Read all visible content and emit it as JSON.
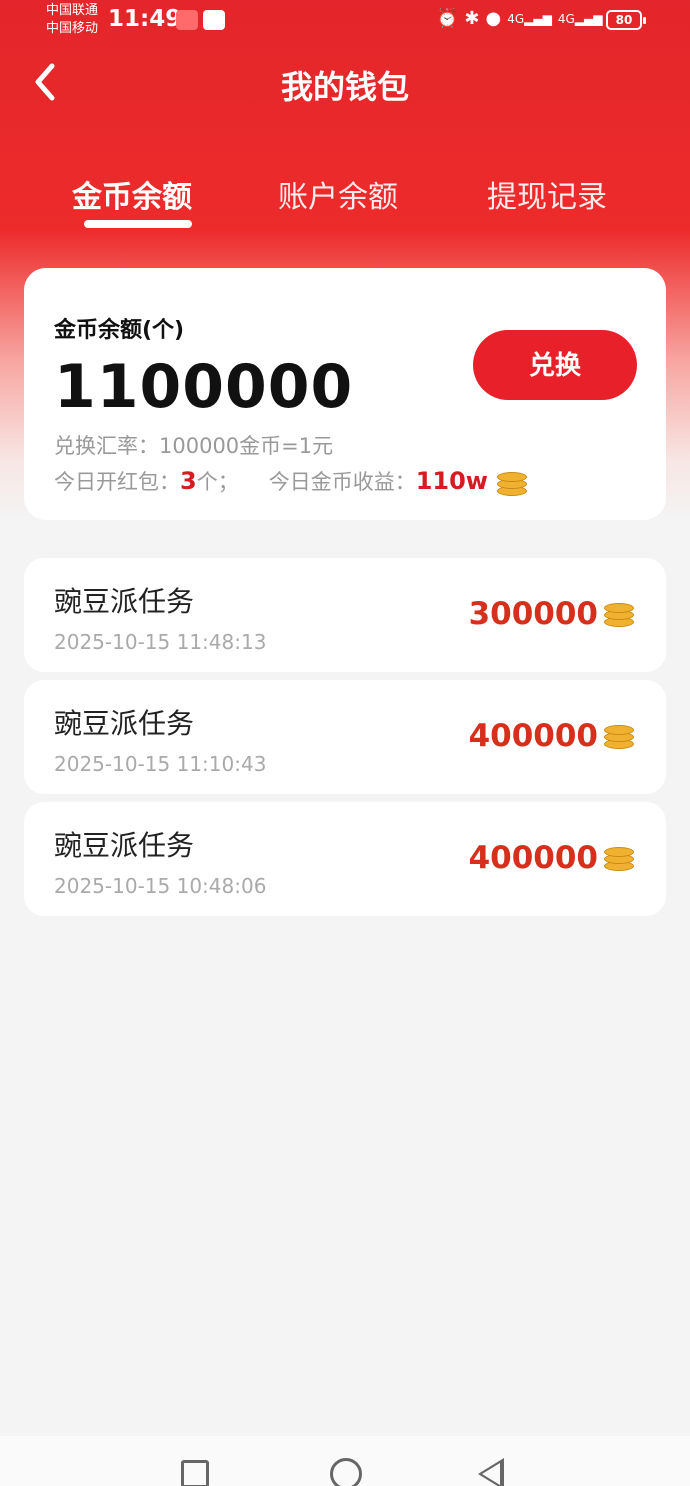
{
  "status_bar": {
    "carrier_1": "中国联通",
    "carrier_2": "中国移动",
    "time": "11:49",
    "battery": "80",
    "network_1": "4G",
    "network_2": "4G"
  },
  "header": {
    "title": "我的钱包",
    "back_icon": "chevron-left-icon"
  },
  "tabs": [
    {
      "label": "金币余额",
      "active": true
    },
    {
      "label": "账户余额",
      "active": false
    },
    {
      "label": "提现记录",
      "active": false
    }
  ],
  "balance_card": {
    "label": "金币余额(个)",
    "amount": "1100000",
    "exchange_button": "兑换",
    "rate_text": "兑换汇率：100000金币=1元",
    "red_packet_label": "今日开红包：",
    "red_packet_count": "3",
    "red_packet_suffix": "个；",
    "income_label": "今日金币收益：",
    "income_value": "110w"
  },
  "records": [
    {
      "title": "豌豆派任务",
      "time": "2025-10-15 11:48:13",
      "amount": "300000"
    },
    {
      "title": "豌豆派任务",
      "time": "2025-10-15 11:10:43",
      "amount": "400000"
    },
    {
      "title": "豌豆派任务",
      "time": "2025-10-15 10:48:06",
      "amount": "400000"
    }
  ],
  "colors": {
    "brand_red": "#e8202a",
    "amount_red": "#d6301c",
    "coin_gold": "#f0b030"
  }
}
